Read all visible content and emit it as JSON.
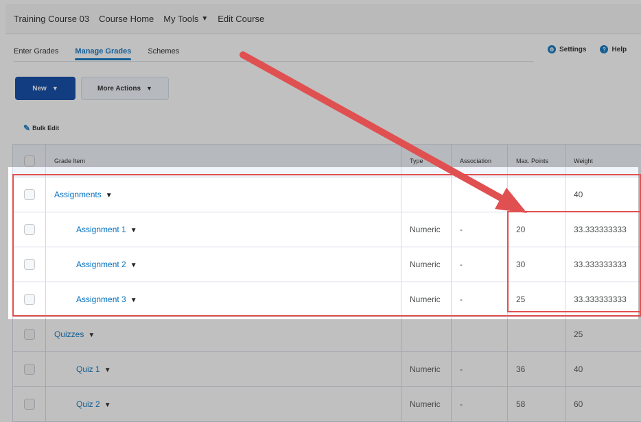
{
  "topnav": {
    "items": [
      {
        "label": "Training Course 03",
        "dropdown": false
      },
      {
        "label": "Course Home",
        "dropdown": false
      },
      {
        "label": "My Tools",
        "dropdown": true
      },
      {
        "label": "Edit Course",
        "dropdown": false
      }
    ]
  },
  "subtabs": {
    "items": [
      {
        "label": "Enter Grades",
        "active": false
      },
      {
        "label": "Manage Grades",
        "active": true
      },
      {
        "label": "Schemes",
        "active": false
      }
    ]
  },
  "tools": {
    "settings": {
      "label": "Settings",
      "icon": "gear-icon"
    },
    "help": {
      "label": "Help",
      "icon": "help-icon"
    }
  },
  "actions": {
    "new_label": "New",
    "more_label": "More Actions",
    "bulk_edit_label": "Bulk Edit"
  },
  "table": {
    "headers": {
      "grade_item": "Grade Item",
      "type": "Type",
      "association": "Association",
      "max_points": "Max. Points",
      "weight": "Weight"
    },
    "rows": [
      {
        "name": "Assignments",
        "type": "",
        "association": "",
        "max_points": "",
        "weight": "40",
        "level": 0
      },
      {
        "name": "Assignment 1",
        "type": "Numeric",
        "association": "-",
        "max_points": "20",
        "weight": "33.333333333",
        "level": 1
      },
      {
        "name": "Assignment 2",
        "type": "Numeric",
        "association": "-",
        "max_points": "30",
        "weight": "33.333333333",
        "level": 1
      },
      {
        "name": "Assignment 3",
        "type": "Numeric",
        "association": "-",
        "max_points": "25",
        "weight": "33.333333333",
        "level": 1
      },
      {
        "name": "Quizzes",
        "type": "",
        "association": "",
        "max_points": "",
        "weight": "25",
        "level": 0
      },
      {
        "name": "Quiz 1",
        "type": "Numeric",
        "association": "-",
        "max_points": "36",
        "weight": "40",
        "level": 1
      },
      {
        "name": "Quiz 2",
        "type": "Numeric",
        "association": "-",
        "max_points": "58",
        "weight": "60",
        "level": 1
      }
    ]
  },
  "colors": {
    "accent": "#006fbf",
    "primary_button": "#003fa3",
    "highlight": "#e05050"
  }
}
